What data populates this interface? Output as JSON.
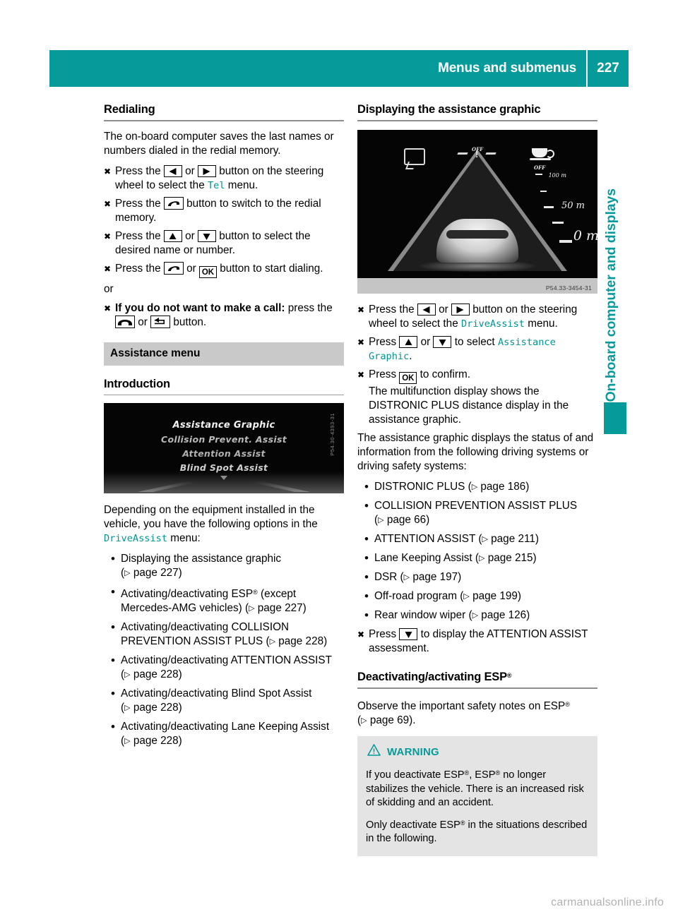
{
  "header": {
    "title": "Menus and submenus",
    "page_number": "227",
    "accent_color": "#079a9a"
  },
  "side_tab": {
    "label": "On-board computer and displays"
  },
  "left_column": {
    "heading": "Redialing",
    "intro": "The on-board computer saves the last names or numbers dialed in the redial memory.",
    "steps": [
      {
        "parts": [
          {
            "t": "text",
            "v": "Press the "
          },
          {
            "t": "key",
            "icon": "arrow-left-key"
          },
          {
            "t": "text",
            "v": " or "
          },
          {
            "t": "key",
            "icon": "arrow-right-key"
          },
          {
            "t": "text",
            "v": " button on the steering wheel to select the "
          },
          {
            "t": "menu",
            "v": "Tel"
          },
          {
            "t": "text",
            "v": " menu."
          }
        ]
      },
      {
        "parts": [
          {
            "t": "text",
            "v": "Press the "
          },
          {
            "t": "key",
            "icon": "phone-pickup-key"
          },
          {
            "t": "text",
            "v": " button to switch to the redial memory."
          }
        ]
      },
      {
        "parts": [
          {
            "t": "text",
            "v": "Press the "
          },
          {
            "t": "key",
            "icon": "arrow-up-key"
          },
          {
            "t": "text",
            "v": " or "
          },
          {
            "t": "key",
            "icon": "arrow-down-key"
          },
          {
            "t": "text",
            "v": " button to select the desired name or number."
          }
        ]
      },
      {
        "parts": [
          {
            "t": "text",
            "v": "Press the "
          },
          {
            "t": "key",
            "icon": "phone-pickup-key"
          },
          {
            "t": "text",
            "v": " or "
          },
          {
            "t": "key",
            "icon": "ok-key",
            "label": "OK"
          },
          {
            "t": "text",
            "v": " button to start dialing."
          }
        ]
      }
    ],
    "or_label": "or",
    "final_step": {
      "bold_lead": "If you do not want to make a call:",
      "parts": [
        {
          "t": "text",
          "v": " press the "
        },
        {
          "t": "key",
          "icon": "phone-hangup-key"
        },
        {
          "t": "text",
          "v": " or "
        },
        {
          "t": "key",
          "icon": "back-key"
        },
        {
          "t": "text",
          "v": " button."
        }
      ]
    },
    "grey_heading": "Assistance menu",
    "sub_heading": "Introduction",
    "figure": {
      "code": "P54.30-4393-31",
      "lines": [
        "Assistance Graphic",
        "Collision Prevent. Assist",
        "Attention Assist",
        "Blind Spot Assist"
      ]
    },
    "options_intro_a": "Depending on the equipment installed in the vehicle, you have the following options in the ",
    "options_intro_menu": "DriveAssist",
    "options_intro_b": " menu:",
    "options": [
      {
        "text": "Displaying the assistance graphic ",
        "ref": "page 227"
      },
      {
        "text": "Activating/deactivating ESP® (except Mercedes-AMG vehicles) ",
        "ref": "page 227"
      },
      {
        "text": "Activating/deactivating COLLISION PREVENTION ASSIST PLUS ",
        "ref": "page 228"
      },
      {
        "text": "Activating/deactivating ATTENTION ASSIST ",
        "ref": "page 228"
      },
      {
        "text": "Activating/deactivating Blind Spot Assist ",
        "ref": "page 228"
      },
      {
        "text": "Activating/deactivating Lane Keeping Assist ",
        "ref": "page 228"
      }
    ]
  },
  "right_column": {
    "heading": "Displaying the assistance graphic",
    "figure": {
      "code": "P54.33-3454-31",
      "scale_labels": [
        "100 m",
        "50 m",
        "0 m"
      ],
      "icon_labels": [
        "OFF",
        "OFF"
      ]
    },
    "steps": [
      {
        "parts": [
          {
            "t": "text",
            "v": "Press the "
          },
          {
            "t": "key",
            "icon": "arrow-left-key"
          },
          {
            "t": "text",
            "v": " or "
          },
          {
            "t": "key",
            "icon": "arrow-right-key"
          },
          {
            "t": "text",
            "v": " button on the steering wheel to select the "
          },
          {
            "t": "menu",
            "v": "DriveAssist"
          },
          {
            "t": "text",
            "v": " menu."
          }
        ]
      },
      {
        "parts": [
          {
            "t": "text",
            "v": "Press "
          },
          {
            "t": "key",
            "icon": "arrow-up-key"
          },
          {
            "t": "text",
            "v": " or "
          },
          {
            "t": "key",
            "icon": "arrow-down-key"
          },
          {
            "t": "text",
            "v": " to select "
          },
          {
            "t": "menu",
            "v": "Assistance Graphic"
          },
          {
            "t": "text",
            "v": "."
          }
        ]
      },
      {
        "parts": [
          {
            "t": "text",
            "v": "Press "
          },
          {
            "t": "key",
            "icon": "ok-key",
            "label": "OK"
          },
          {
            "t": "text",
            "v": " to confirm."
          }
        ],
        "follow": "The multifunction display shows the DISTRONIC PLUS distance display in the assistance graphic."
      }
    ],
    "systems_intro": "The assistance graphic displays the status of and information from the following driving systems or driving safety systems:",
    "systems": [
      {
        "text": "DISTRONIC PLUS ",
        "ref": "page 186"
      },
      {
        "text": "COLLISION PREVENTION ASSIST PLUS ",
        "ref": "page 66"
      },
      {
        "text": "ATTENTION ASSIST ",
        "ref": "page 211"
      },
      {
        "text": "Lane Keeping Assist ",
        "ref": "page 215"
      },
      {
        "text": "DSR ",
        "ref": "page 197"
      },
      {
        "text": "Off-road program ",
        "ref": "page 199"
      },
      {
        "text": "Rear window wiper ",
        "ref": "page 126"
      }
    ],
    "last_step": {
      "parts": [
        {
          "t": "text",
          "v": "Press "
        },
        {
          "t": "key",
          "icon": "arrow-down-key"
        },
        {
          "t": "text",
          "v": " to display the ATTENTION ASSIST assessment."
        }
      ]
    },
    "esp_heading": "Deactivating/activating ESP®",
    "esp_note_a": "Observe the important safety notes on ESP® (",
    "esp_note_ref": "page 69",
    "esp_note_b": ").",
    "warning": {
      "title": "WARNING",
      "paragraphs": [
        "If you deactivate ESP®, ESP® no longer stabilizes the vehicle. There is an increased risk of skidding and an accident.",
        "Only deactivate ESP® in the situations described in the following."
      ]
    }
  },
  "watermark": "carmanualsonline.info"
}
